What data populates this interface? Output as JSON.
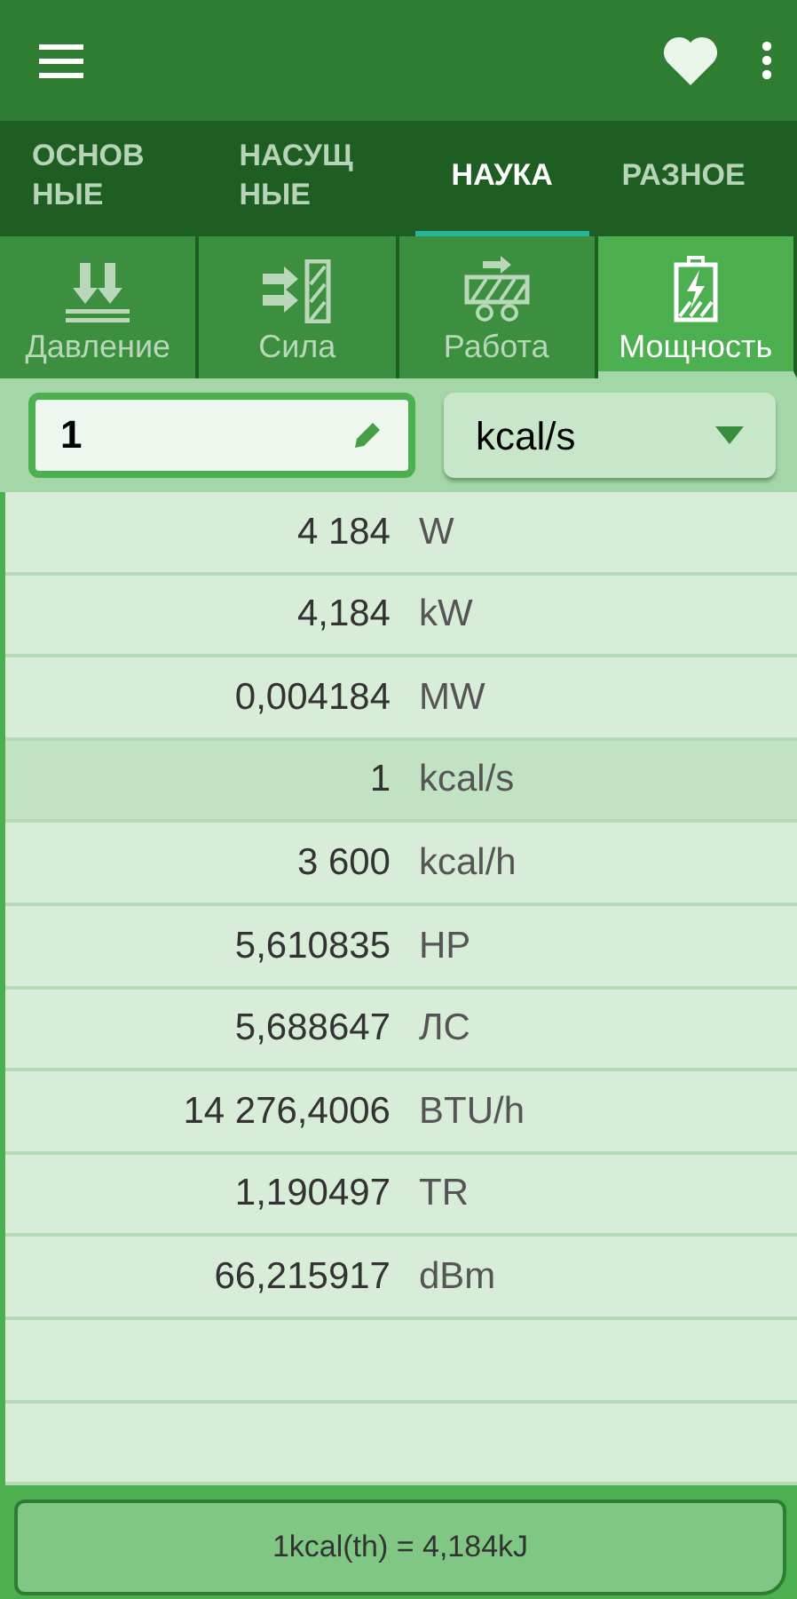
{
  "tabs": [
    {
      "label": "ОСНОВ\nНЫЕ",
      "selected": false
    },
    {
      "label": "НАСУЩ\nНЫЕ",
      "selected": false
    },
    {
      "label": "НАУКА",
      "selected": true
    },
    {
      "label": "РАЗНОЕ",
      "selected": false
    }
  ],
  "categories": [
    {
      "kind": "pressure",
      "label": "Давление",
      "selected": false
    },
    {
      "kind": "force",
      "label": "Сила",
      "selected": false
    },
    {
      "kind": "work",
      "label": "Работа",
      "selected": false
    },
    {
      "kind": "power",
      "label": "Мощность",
      "selected": true
    }
  ],
  "input": {
    "value": "1"
  },
  "unit_select": {
    "value": "kcal/s"
  },
  "results": [
    {
      "value": "4 184",
      "unit": "W",
      "selected": false
    },
    {
      "value": "4,184",
      "unit": "kW",
      "selected": false
    },
    {
      "value": "0,004184",
      "unit": "MW",
      "selected": false
    },
    {
      "value": "1",
      "unit": "kcal/s",
      "selected": true
    },
    {
      "value": "3 600",
      "unit": "kcal/h",
      "selected": false
    },
    {
      "value": "5,610835",
      "unit": "HP",
      "selected": false
    },
    {
      "value": "5,688647",
      "unit": "ЛС",
      "selected": false
    },
    {
      "value": "14 276,4006",
      "unit": "BTU/h",
      "selected": false
    },
    {
      "value": "1,190497",
      "unit": "TR",
      "selected": false
    },
    {
      "value": "66,215917",
      "unit": "dBm",
      "selected": false
    }
  ],
  "footer": {
    "text": "1kcal(th) = 4,184kJ"
  }
}
